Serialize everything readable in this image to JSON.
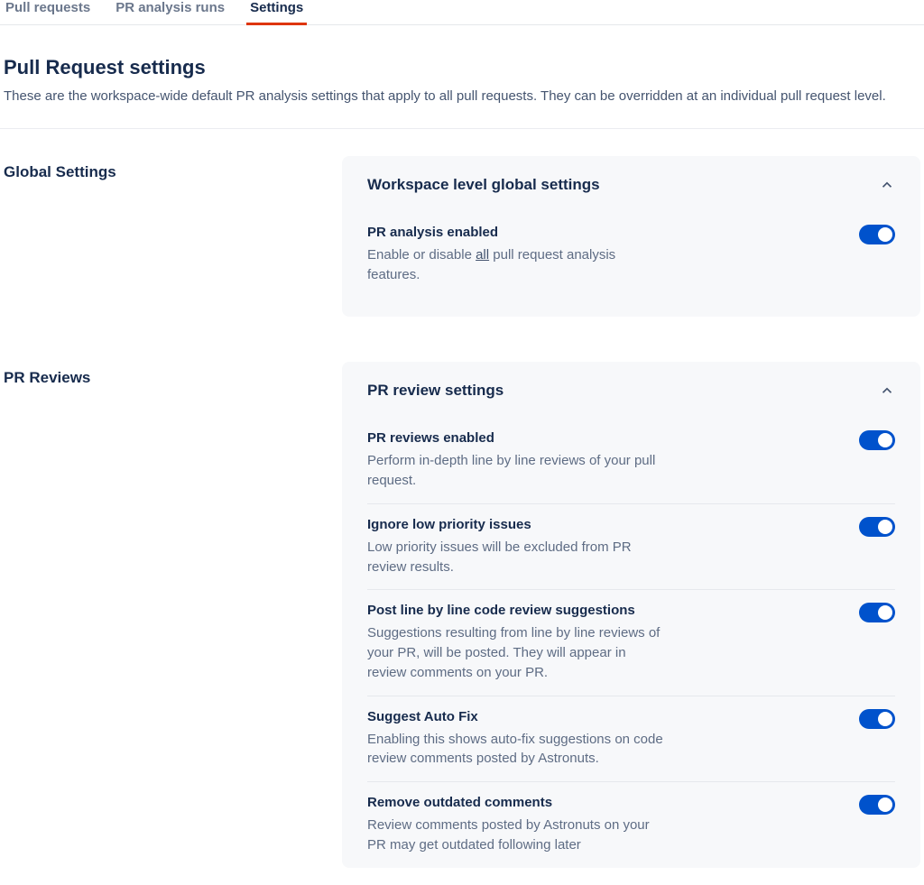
{
  "tabs": [
    {
      "label": "Pull requests",
      "active": false
    },
    {
      "label": "PR analysis runs",
      "active": false
    },
    {
      "label": "Settings",
      "active": true
    }
  ],
  "header": {
    "title": "Pull Request settings",
    "description": "These are the workspace-wide default PR analysis settings that apply to all pull requests. They can be overridden at an individual pull request level."
  },
  "sections": {
    "global": {
      "label": "Global Settings",
      "panel_title": "Workspace level global settings",
      "settings": [
        {
          "title": "PR analysis enabled",
          "desc_pre": "Enable or disable ",
          "desc_underline": "all",
          "desc_post": " pull request analysis features.",
          "enabled": true
        }
      ]
    },
    "reviews": {
      "label": "PR Reviews",
      "panel_title": "PR review settings",
      "settings": [
        {
          "title": "PR reviews enabled",
          "desc": "Perform in-depth line by line reviews of your pull request.",
          "enabled": true
        },
        {
          "title": "Ignore low priority issues",
          "desc": "Low priority issues will be excluded from PR review results.",
          "enabled": true
        },
        {
          "title": "Post line by line code review suggestions",
          "desc": "Suggestions resulting from line by line reviews of your PR, will be posted. They will appear in review comments on your PR.",
          "enabled": true
        },
        {
          "title": "Suggest Auto Fix",
          "desc": "Enabling this shows auto-fix suggestions on code review comments posted by Astronuts.",
          "enabled": true
        },
        {
          "title": "Remove outdated comments",
          "desc": "Review comments posted by Astronuts on your PR may get outdated following later",
          "enabled": true
        }
      ]
    }
  }
}
